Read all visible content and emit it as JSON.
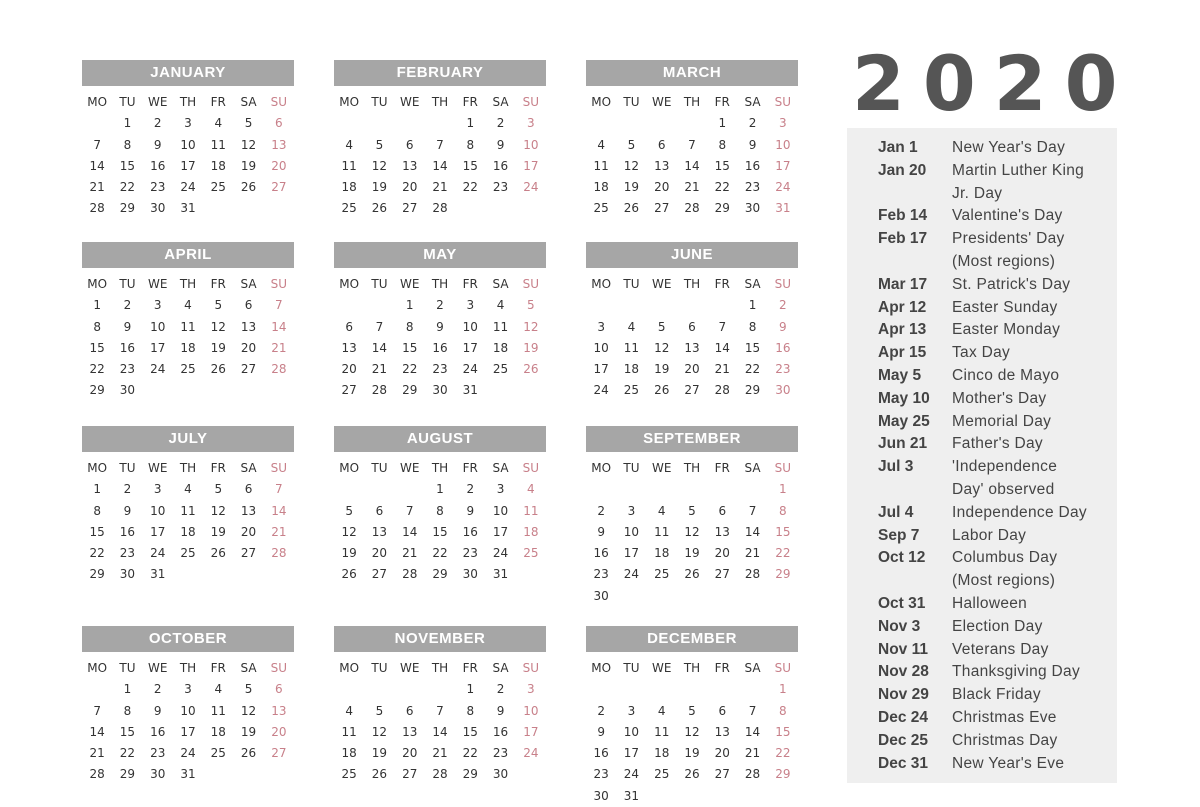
{
  "year": "2020",
  "weekday_headers": [
    "MO",
    "TU",
    "WE",
    "TH",
    "FR",
    "SA",
    "SU"
  ],
  "colors": {
    "header_band": "#a6a6a6",
    "sunday": "#c8808a",
    "text": "#333333",
    "holiday_panel": "#efefef",
    "year_text": "#555555"
  },
  "months": [
    {
      "name": "JANUARY",
      "offset": 1,
      "days": 31
    },
    {
      "name": "FEBRUARY",
      "offset": 4,
      "days": 28
    },
    {
      "name": "MARCH",
      "offset": 4,
      "days": 31
    },
    {
      "name": "APRIL",
      "offset": 0,
      "days": 30
    },
    {
      "name": "MAY",
      "offset": 2,
      "days": 31
    },
    {
      "name": "JUNE",
      "offset": 5,
      "days": 30
    },
    {
      "name": "JULY",
      "offset": 0,
      "days": 31
    },
    {
      "name": "AUGUST",
      "offset": 3,
      "days": 31
    },
    {
      "name": "SEPTEMBER",
      "offset": 6,
      "days": 30
    },
    {
      "name": "OCTOBER",
      "offset": 1,
      "days": 31
    },
    {
      "name": "NOVEMBER",
      "offset": 4,
      "days": 30
    },
    {
      "name": "DECEMBER",
      "offset": 6,
      "days": 31
    }
  ],
  "holidays": [
    {
      "date": "Jan 1",
      "name": "New Year's Day"
    },
    {
      "date": "Jan 20",
      "name": "Martin Luther King Jr. Day"
    },
    {
      "date": "Feb 14",
      "name": "Valentine's Day"
    },
    {
      "date": "Feb 17",
      "name": "Presidents' Day (Most regions)"
    },
    {
      "date": "Mar 17",
      "name": "St. Patrick's Day"
    },
    {
      "date": "Apr 12",
      "name": "Easter Sunday"
    },
    {
      "date": "Apr 13",
      "name": "Easter Monday"
    },
    {
      "date": "Apr 15",
      "name": "Tax Day"
    },
    {
      "date": "May 5",
      "name": "Cinco de Mayo"
    },
    {
      "date": "May 10",
      "name": "Mother's Day"
    },
    {
      "date": "May 25",
      "name": "Memorial Day"
    },
    {
      "date": "Jun 21",
      "name": "Father's Day"
    },
    {
      "date": "Jul 3",
      "name": "'Independence Day' observed"
    },
    {
      "date": "Jul 4",
      "name": "Independence Day"
    },
    {
      "date": "Sep 7",
      "name": "Labor Day"
    },
    {
      "date": "Oct 12",
      "name": "Columbus Day (Most regions)"
    },
    {
      "date": "Oct 31",
      "name": "Halloween"
    },
    {
      "date": "Nov 3",
      "name": "Election Day"
    },
    {
      "date": "Nov 11",
      "name": "Veterans Day"
    },
    {
      "date": "Nov 28",
      "name": "Thanksgiving Day"
    },
    {
      "date": "Nov 29",
      "name": "Black Friday"
    },
    {
      "date": "Dec 24",
      "name": "Christmas Eve"
    },
    {
      "date": "Dec 25",
      "name": "Christmas Day"
    },
    {
      "date": "Dec 31",
      "name": "New Year's Eve"
    }
  ]
}
